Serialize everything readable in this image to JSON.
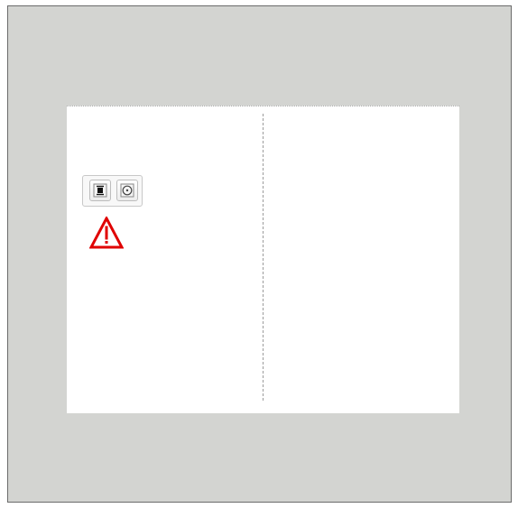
{
  "screen": {
    "background_color": "#d3d4d1",
    "page_color": "#ffffff",
    "frame_border_color": "#6b6b6b"
  },
  "controls": {
    "group_name": "image-controls",
    "buttons": [
      {
        "icon": "align-center-icon"
      },
      {
        "icon": "record-icon"
      }
    ]
  },
  "warning": {
    "icon": "warning-triangle-icon",
    "color": "#e00000"
  }
}
